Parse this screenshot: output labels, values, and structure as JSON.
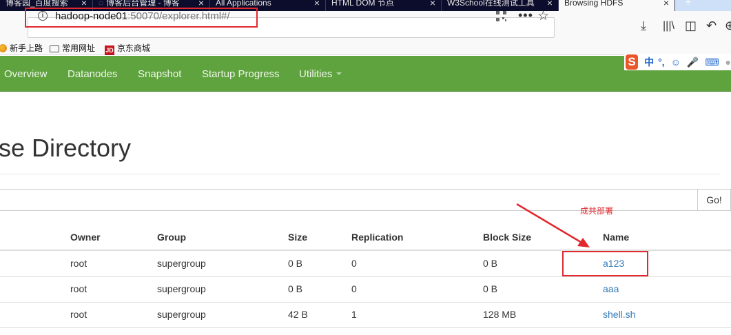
{
  "browser": {
    "tabs": [
      {
        "title": "博客园_百度搜索"
      },
      {
        "title": "博客后台管理 - 博客"
      },
      {
        "title": "All Applications"
      },
      {
        "title": "HTML DOM 节点"
      },
      {
        "title": "W3School在线测试工具"
      },
      {
        "title": "Browsing HDFS",
        "active": true
      }
    ],
    "url": {
      "host": "hadoop-node01",
      "rest": ":50070/explorer.html#/"
    },
    "bookmarks": [
      "新手上路",
      "常用网址",
      "京东商城"
    ],
    "jd_badge": "JD",
    "new_tab": "+"
  },
  "ime": {
    "logo": "S",
    "lang": "中",
    "punct": "°,"
  },
  "nav": {
    "items": [
      "Overview",
      "Datanodes",
      "Snapshot",
      "Startup Progress",
      "Utilities"
    ]
  },
  "page": {
    "title": "se Directory",
    "go_label": "Go!",
    "annotation": "成共部署"
  },
  "table": {
    "headers": [
      "Owner",
      "Group",
      "Size",
      "Replication",
      "Block Size",
      "Name"
    ],
    "rows": [
      {
        "owner": "root",
        "group": "supergroup",
        "size": "0 B",
        "replication": "0",
        "block_size": "0 B",
        "name": "a123"
      },
      {
        "owner": "root",
        "group": "supergroup",
        "size": "0 B",
        "replication": "0",
        "block_size": "0 B",
        "name": "aaa"
      },
      {
        "owner": "root",
        "group": "supergroup",
        "size": "42 B",
        "replication": "1",
        "block_size": "128 MB",
        "name": "shell.sh"
      }
    ]
  },
  "colors": {
    "nav_green": "#5fa33e",
    "link": "#337ab7",
    "annotation_red": "#e0282e"
  }
}
